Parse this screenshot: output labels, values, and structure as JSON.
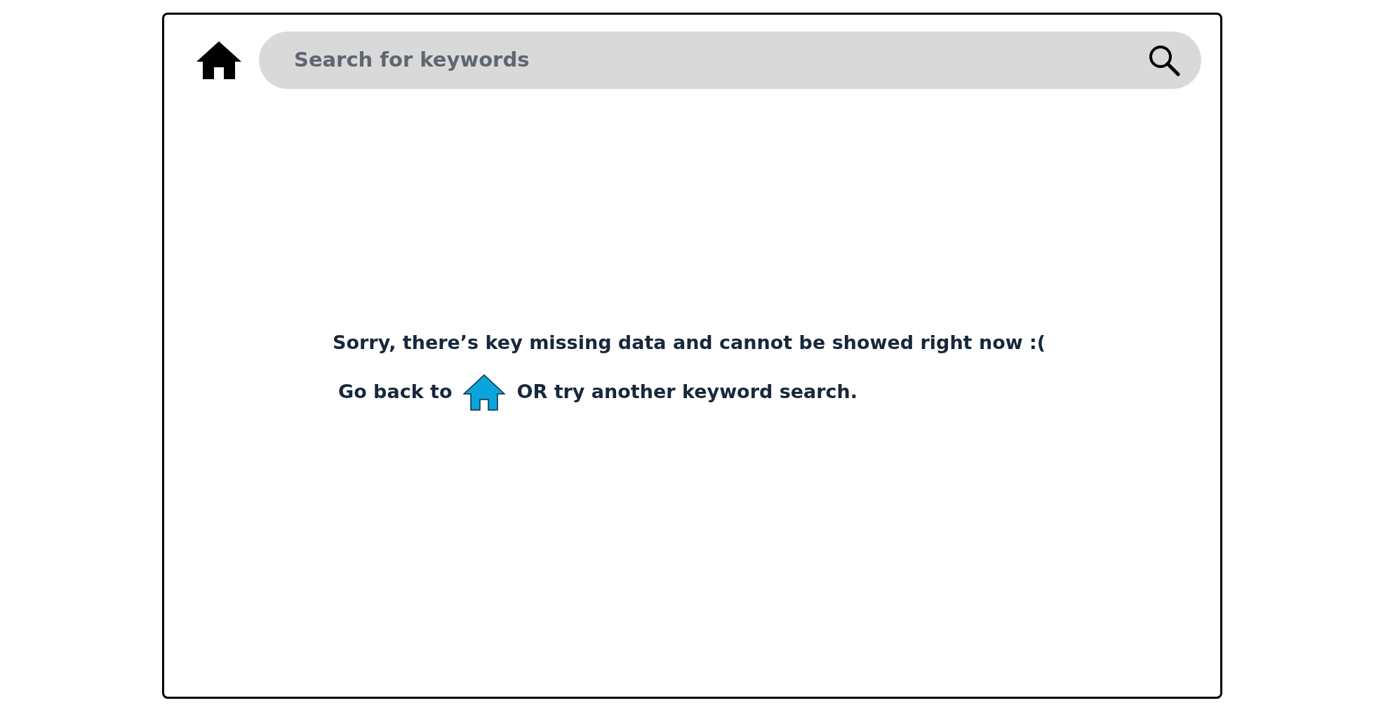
{
  "search": {
    "placeholder": "Search for keywords"
  },
  "message": "Sorry, there’s key missing data and cannot be showed right now :(",
  "hint": {
    "before": "Go back to",
    "after": "OR try another keyword search."
  }
}
